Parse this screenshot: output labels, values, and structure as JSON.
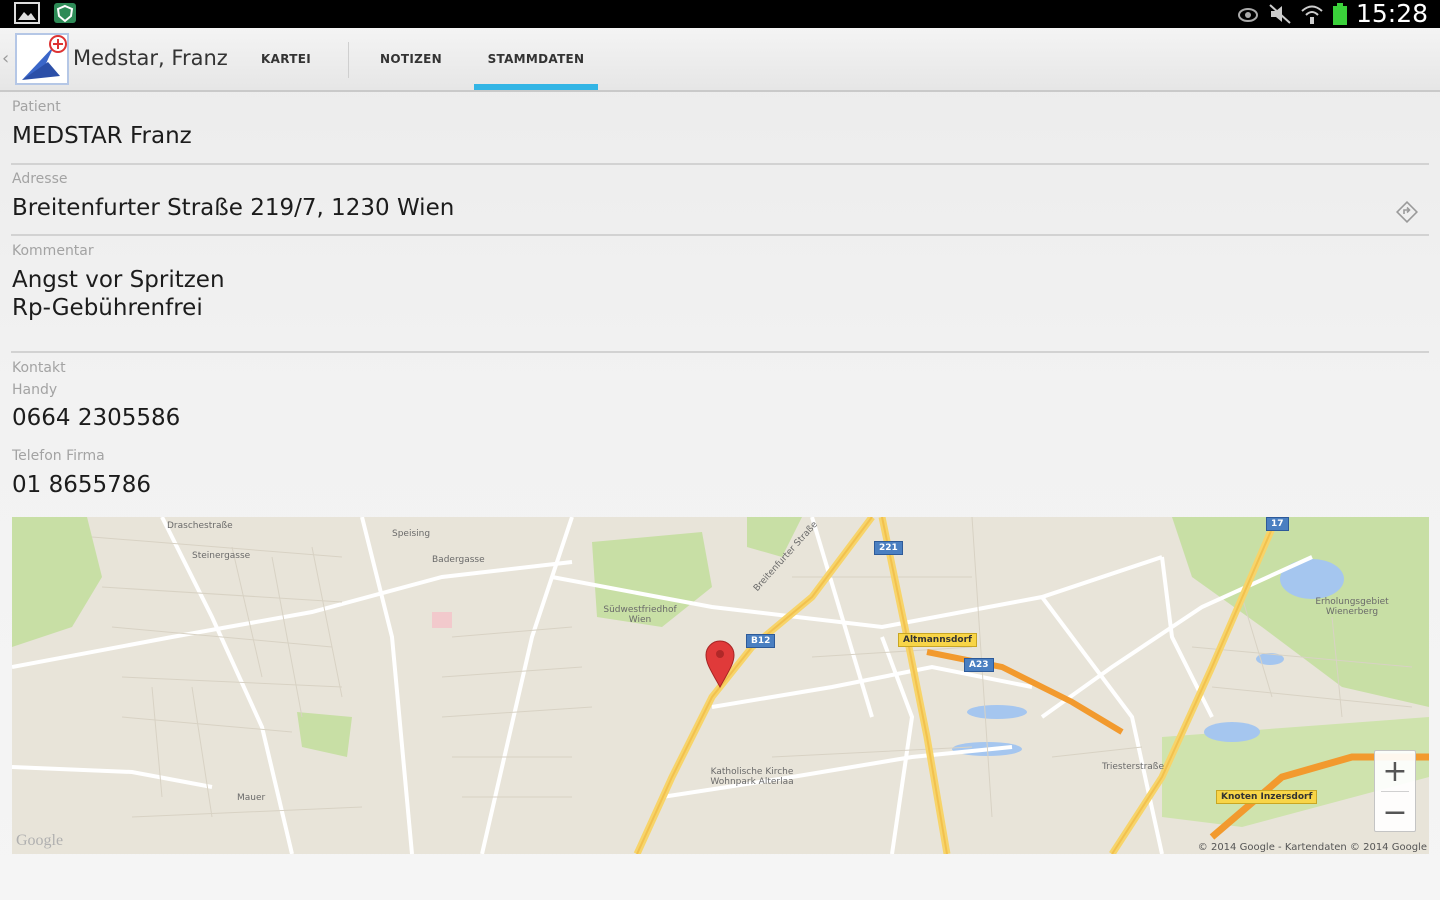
{
  "status_bar": {
    "time": "15:28",
    "left_icons": [
      "gallery-icon",
      "shield-icon"
    ],
    "right_icons": [
      "eye-icon",
      "mute-icon",
      "wifi-icon",
      "battery-icon"
    ]
  },
  "action_bar": {
    "app_icon": "medstar-logo-icon",
    "patient_name": "Medstar, Franz",
    "tabs": [
      {
        "label": "KARTEI",
        "active": false
      },
      {
        "label": "NOTIZEN",
        "active": false
      },
      {
        "label": "STAMMDATEN",
        "active": true
      }
    ],
    "accent_color": "#33b5e5"
  },
  "fields": {
    "patient": {
      "label": "Patient",
      "value": "MEDSTAR Franz"
    },
    "address": {
      "label": "Adresse",
      "value": "Breitenfurter Straße 219/7, 1230 Wien",
      "action_icon": "navigate-icon"
    },
    "comment": {
      "label": "Kommentar",
      "lines": [
        "Angst vor Spritzen",
        "Rp-Gebührenfrei"
      ]
    },
    "contact": {
      "label": "Kontakt",
      "mobile": {
        "label": "Handy",
        "value": "0664 2305586"
      },
      "work_phone": {
        "label": "Telefon Firma",
        "value": "01 8655786"
      }
    }
  },
  "map": {
    "street_labels": [
      "Breitenfurter Straße",
      "Südwestfriedhof Wien",
      "Altmannsdorf",
      "Katholische Kirche Wohnpark Alterlaa",
      "Erholungsgebiet Wienerberg",
      "Knoten Inzersdorf",
      "Draschestraße",
      "Steinergasse",
      "Speising",
      "Badergasse",
      "Mauer",
      "Triesterstraße"
    ],
    "route_labels": [
      "A23",
      "B12",
      "221",
      "17"
    ],
    "zoom_in": "+",
    "zoom_out": "−",
    "brand": "Google",
    "attribution": "© 2014 Google - Kartendaten © 2014 Google",
    "pin_color": "#e03a3a"
  }
}
